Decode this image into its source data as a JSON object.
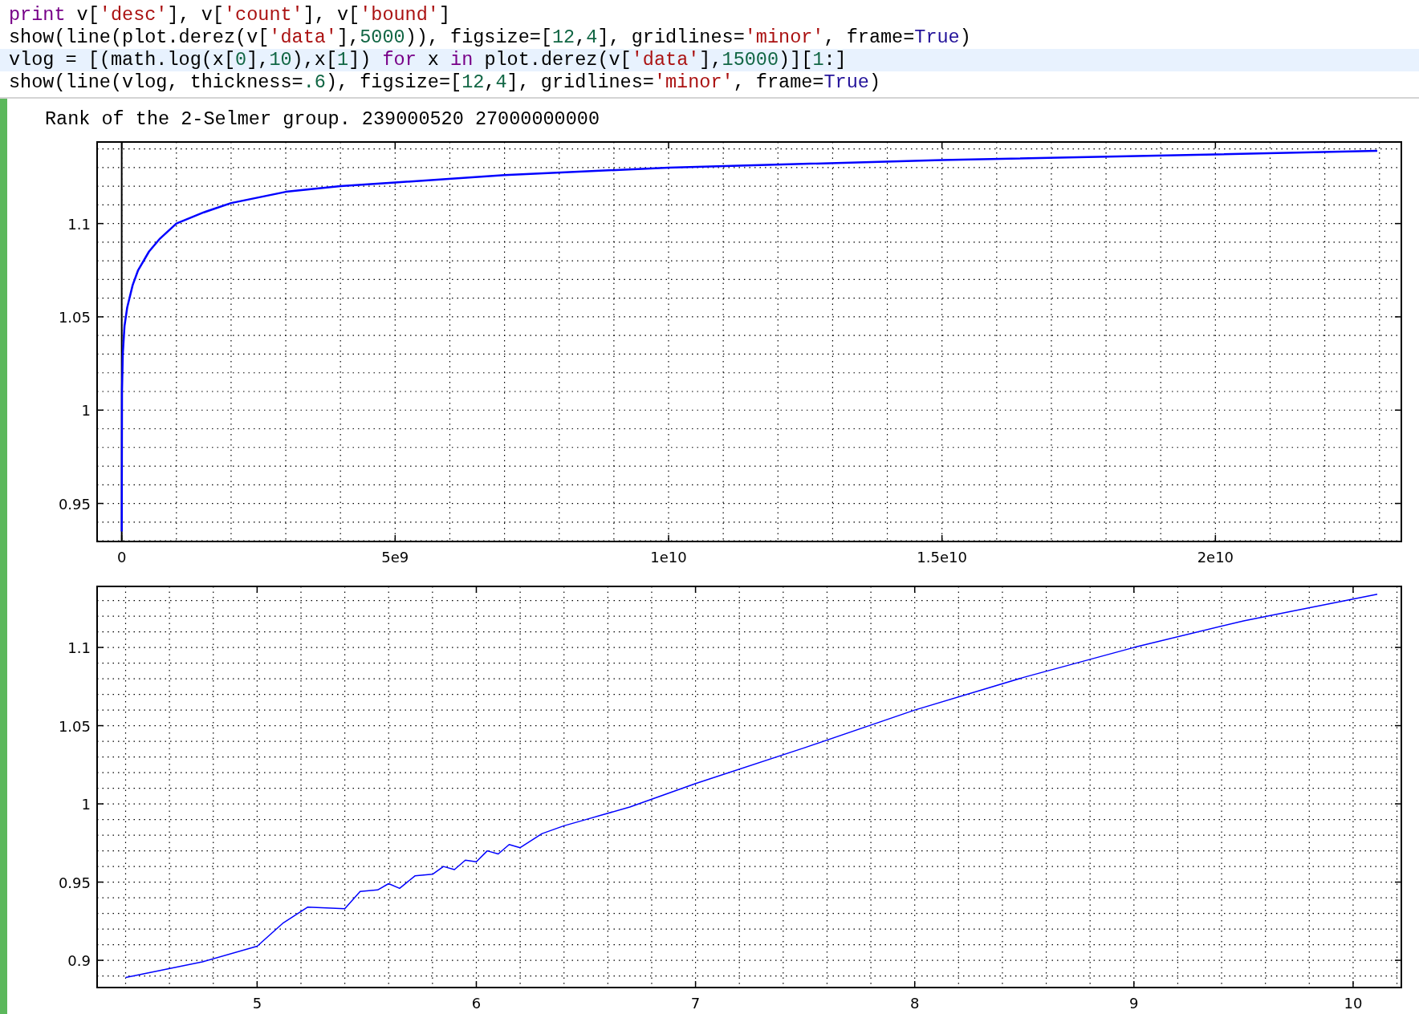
{
  "code": {
    "lines": [
      {
        "active": false,
        "tokens": [
          {
            "text": "print",
            "kind": "keyword"
          },
          {
            "text": " v[",
            "kind": "plain"
          },
          {
            "text": "'desc'",
            "kind": "string"
          },
          {
            "text": "], v[",
            "kind": "plain"
          },
          {
            "text": "'count'",
            "kind": "string"
          },
          {
            "text": "], v[",
            "kind": "plain"
          },
          {
            "text": "'bound'",
            "kind": "string"
          },
          {
            "text": "]",
            "kind": "plain"
          }
        ]
      },
      {
        "active": false,
        "tokens": [
          {
            "text": "show(line(plot.derez(v[",
            "kind": "plain"
          },
          {
            "text": "'data'",
            "kind": "string"
          },
          {
            "text": "],",
            "kind": "plain"
          },
          {
            "text": "5000",
            "kind": "number"
          },
          {
            "text": ")), figsize=[",
            "kind": "plain"
          },
          {
            "text": "12",
            "kind": "number"
          },
          {
            "text": ",",
            "kind": "plain"
          },
          {
            "text": "4",
            "kind": "number"
          },
          {
            "text": "], gridlines=",
            "kind": "plain"
          },
          {
            "text": "'minor'",
            "kind": "string"
          },
          {
            "text": ", frame=",
            "kind": "plain"
          },
          {
            "text": "True",
            "kind": "atom"
          },
          {
            "text": ")",
            "kind": "plain"
          }
        ]
      },
      {
        "active": true,
        "tokens": [
          {
            "text": "vlog = [(math.log(x[",
            "kind": "plain"
          },
          {
            "text": "0",
            "kind": "number"
          },
          {
            "text": "],",
            "kind": "plain"
          },
          {
            "text": "10",
            "kind": "number"
          },
          {
            "text": "),x[",
            "kind": "plain"
          },
          {
            "text": "1",
            "kind": "number"
          },
          {
            "text": "]) ",
            "kind": "plain"
          },
          {
            "text": "for",
            "kind": "keyword"
          },
          {
            "text": " x ",
            "kind": "plain"
          },
          {
            "text": "in",
            "kind": "keyword"
          },
          {
            "text": " plot.derez(v[",
            "kind": "plain"
          },
          {
            "text": "'data'",
            "kind": "string"
          },
          {
            "text": "],",
            "kind": "plain"
          },
          {
            "text": "15000",
            "kind": "number"
          },
          {
            "text": ")][",
            "kind": "plain"
          },
          {
            "text": "1",
            "kind": "number"
          },
          {
            "text": ":]",
            "kind": "plain"
          }
        ]
      },
      {
        "active": false,
        "tokens": [
          {
            "text": "show(line(vlog, thickness=",
            "kind": "plain"
          },
          {
            "text": ".6",
            "kind": "number"
          },
          {
            "text": "), figsize=[",
            "kind": "plain"
          },
          {
            "text": "12",
            "kind": "number"
          },
          {
            "text": ",",
            "kind": "plain"
          },
          {
            "text": "4",
            "kind": "number"
          },
          {
            "text": "], gridlines=",
            "kind": "plain"
          },
          {
            "text": "'minor'",
            "kind": "string"
          },
          {
            "text": ", frame=",
            "kind": "plain"
          },
          {
            "text": "True",
            "kind": "atom"
          },
          {
            "text": ")",
            "kind": "plain"
          }
        ]
      }
    ]
  },
  "output": {
    "text": "Rank of the 2-Selmer group. 239000520 27000000000",
    "charts": [
      {
        "chart_data": {
          "type": "line",
          "x": [
            0,
            5000000,
            20000000,
            50000000,
            100000000,
            200000000,
            300000000,
            500000000,
            700000000,
            1000000000,
            1500000000,
            2000000000,
            3000000000,
            4000000000,
            5000000000,
            7000000000,
            10000000000,
            15000000000,
            20000000000,
            22960000000
          ],
          "grid": true,
          "series": [
            {
              "color": "#0000ff",
              "values": [
                0.935,
                1.01,
                1.03,
                1.045,
                1.055,
                1.067,
                1.075,
                1.085,
                1.092,
                1.1,
                1.106,
                1.111,
                1.117,
                1.12,
                1.122,
                1.126,
                1.13,
                1.134,
                1.137,
                1.139
              ]
            }
          ],
          "xlim": [
            -450000000,
            23400000000
          ],
          "ylim": [
            0.9296,
            1.1437
          ],
          "xticks": [
            {
              "value": 0,
              "label": "0"
            },
            {
              "value": 5000000000,
              "label": "5e9"
            },
            {
              "value": 10000000000,
              "label": "1e10"
            },
            {
              "value": 15000000000,
              "label": "1.5e10"
            },
            {
              "value": 20000000000,
              "label": "2e10"
            }
          ],
          "yticks": [
            {
              "value": 0.95,
              "label": "0.95"
            },
            {
              "value": 1,
              "label": "1"
            },
            {
              "value": 1.05,
              "label": "1.05"
            },
            {
              "value": 1.1,
              "label": "1.1"
            }
          ]
        }
      },
      {
        "chart_data": {
          "type": "line",
          "x": [
            4.4,
            4.75,
            5.0,
            5.12,
            5.23,
            5.4,
            5.47,
            5.55,
            5.6,
            5.65,
            5.72,
            5.8,
            5.85,
            5.9,
            5.95,
            6.0,
            6.05,
            6.1,
            6.15,
            6.2,
            6.3,
            6.4,
            6.5,
            6.7,
            7.0,
            7.5,
            8.0,
            8.5,
            9.0,
            9.5,
            10.11
          ],
          "grid": true,
          "series": [
            {
              "color": "#0000ff",
              "values": [
                0.889,
                0.899,
                0.909,
                0.924,
                0.934,
                0.933,
                0.944,
                0.945,
                0.949,
                0.946,
                0.954,
                0.955,
                0.96,
                0.958,
                0.964,
                0.963,
                0.97,
                0.968,
                0.974,
                0.972,
                0.981,
                0.986,
                0.99,
                0.998,
                1.013,
                1.036,
                1.06,
                1.081,
                1.1,
                1.117,
                1.134
              ]
            }
          ],
          "xlim": [
            4.27,
            10.22
          ],
          "ylim": [
            0.8826,
            1.139
          ],
          "xticks": [
            {
              "value": 5,
              "label": "5"
            },
            {
              "value": 6,
              "label": "6"
            },
            {
              "value": 7,
              "label": "7"
            },
            {
              "value": 8,
              "label": "8"
            },
            {
              "value": 9,
              "label": "9"
            },
            {
              "value": 10,
              "label": "10"
            }
          ],
          "yticks": [
            {
              "value": 0.9,
              "label": "0.9"
            },
            {
              "value": 0.95,
              "label": "0.95"
            },
            {
              "value": 1,
              "label": "1"
            },
            {
              "value": 1.05,
              "label": "1.05"
            },
            {
              "value": 1.1,
              "label": "1.1"
            }
          ]
        }
      }
    ]
  }
}
